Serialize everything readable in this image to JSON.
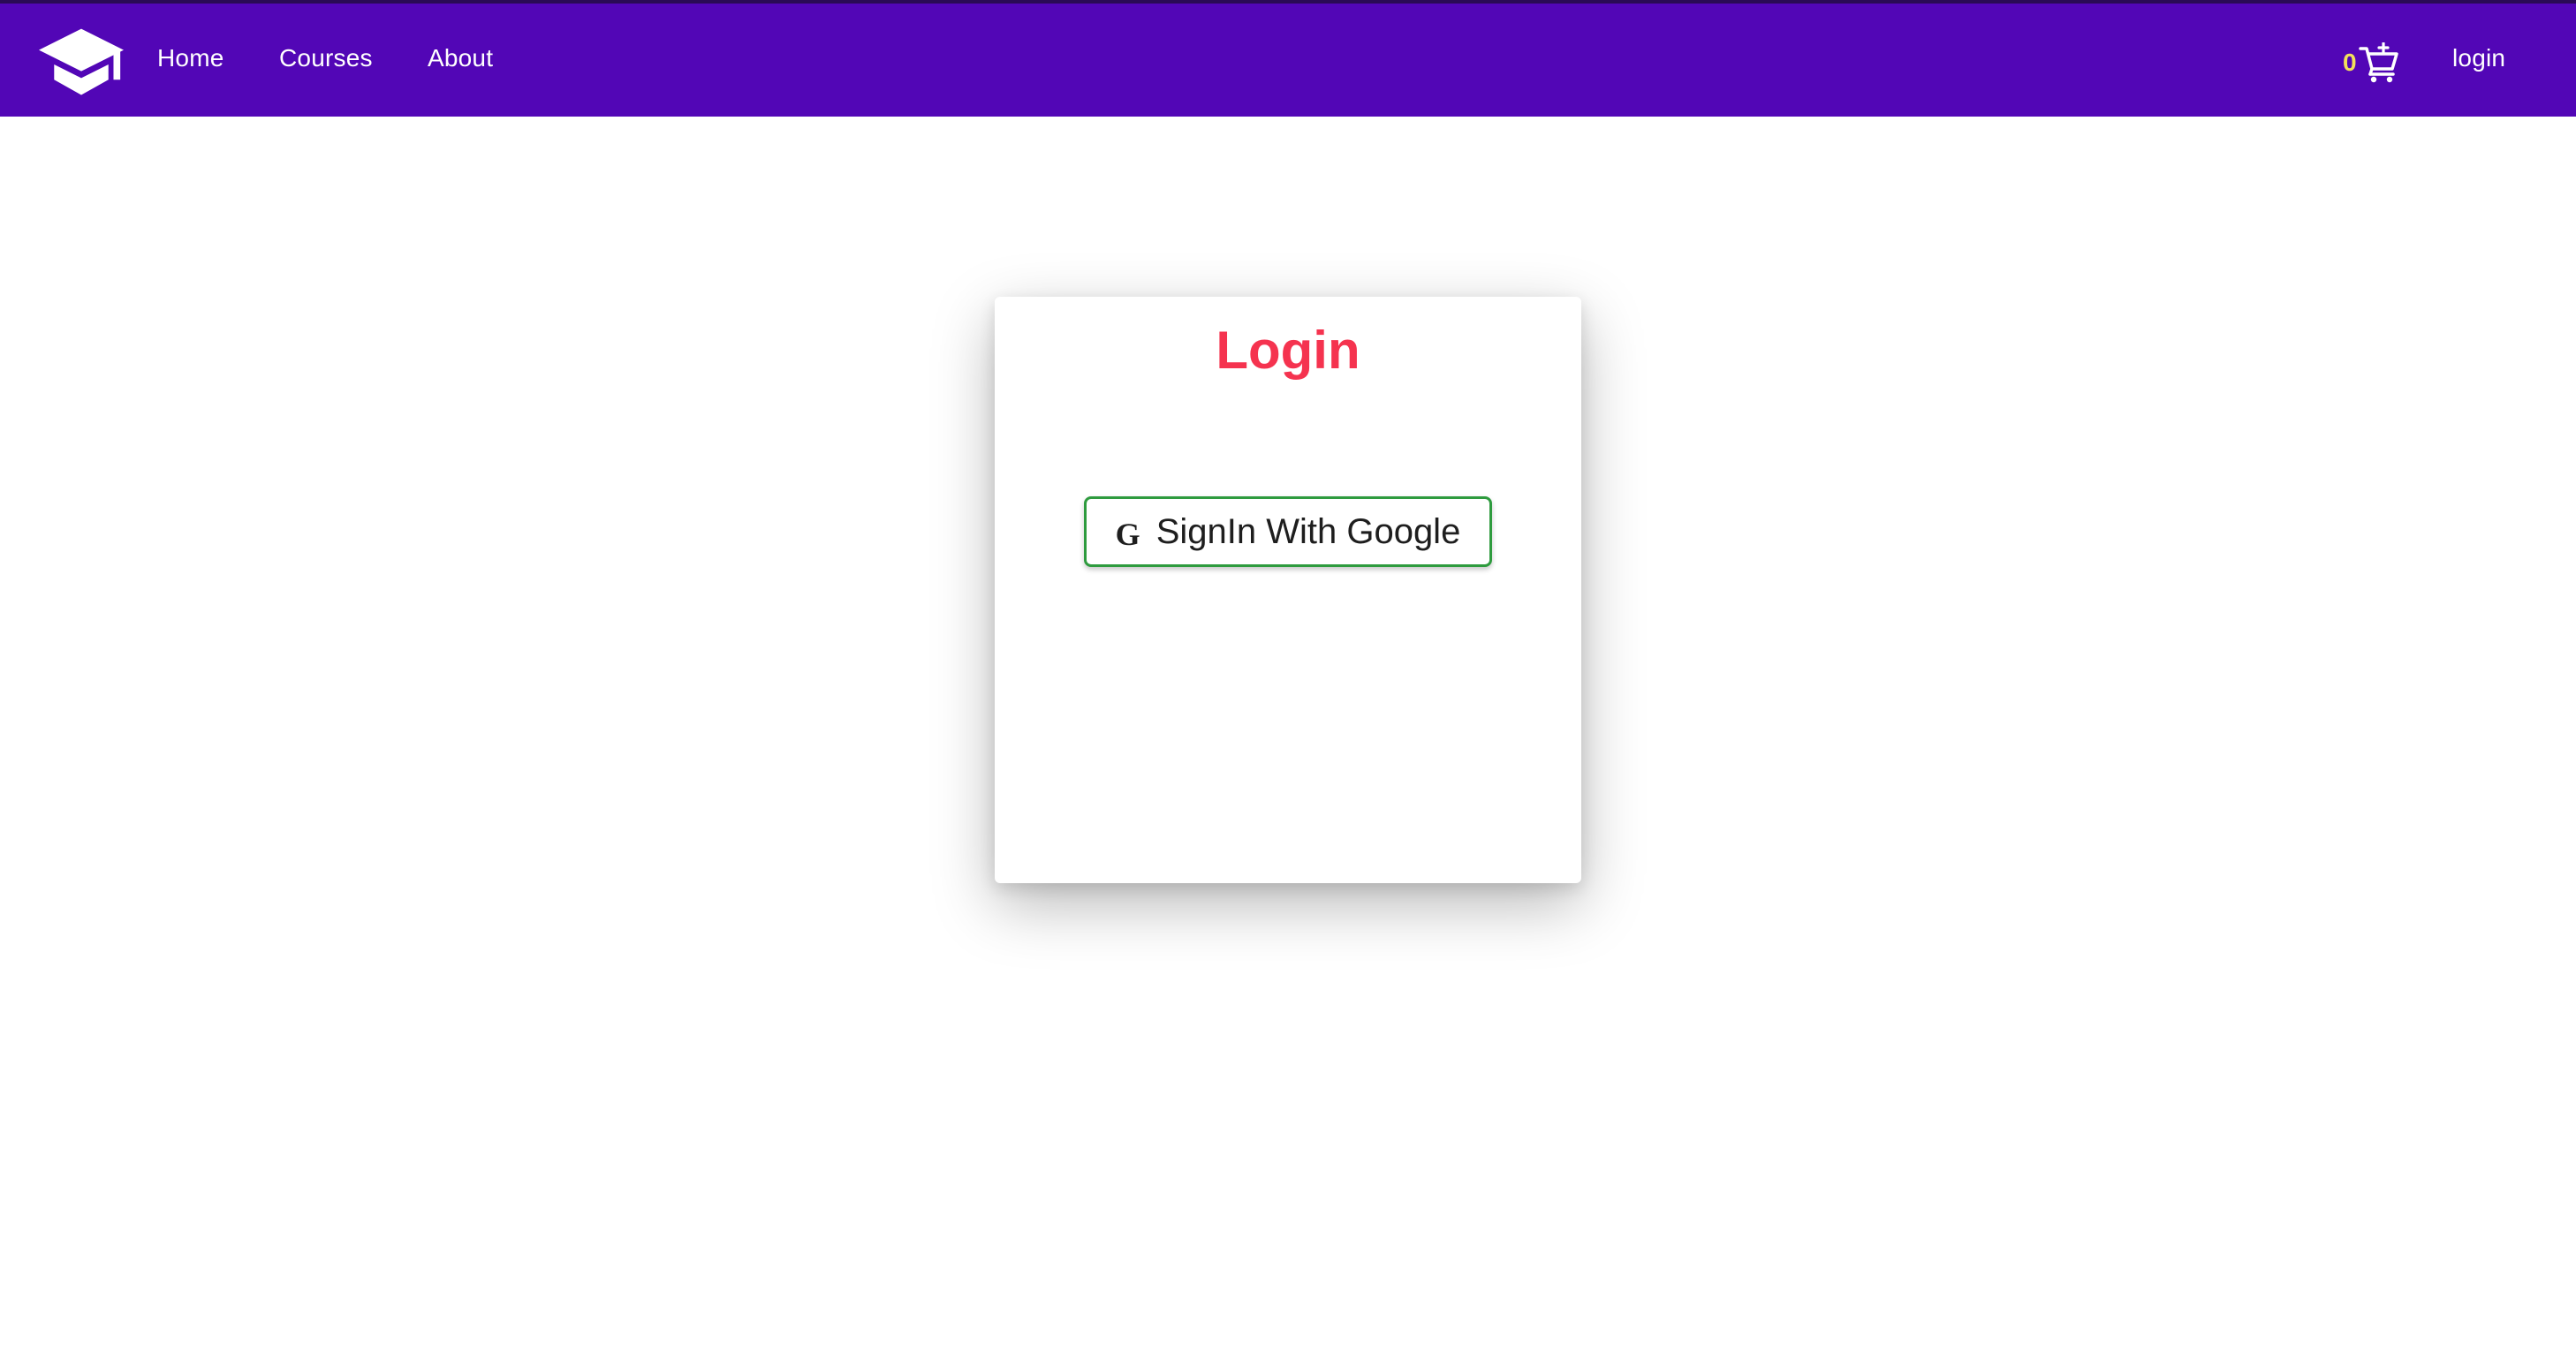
{
  "navbar": {
    "background_color": "#5206b6",
    "logo_icon": "graduation-cap-icon",
    "links": {
      "home": "Home",
      "courses": "Courses",
      "about": "About"
    },
    "cart": {
      "count": "0",
      "icon": "add-to-cart-icon",
      "count_color": "#f3e15a"
    },
    "login_label": "login"
  },
  "login_card": {
    "title": "Login",
    "title_color": "#f5334f",
    "google_button": {
      "icon": "G",
      "icon_name": "google-icon",
      "label": "SignIn With Google",
      "border_color": "#2e9b3e"
    }
  }
}
